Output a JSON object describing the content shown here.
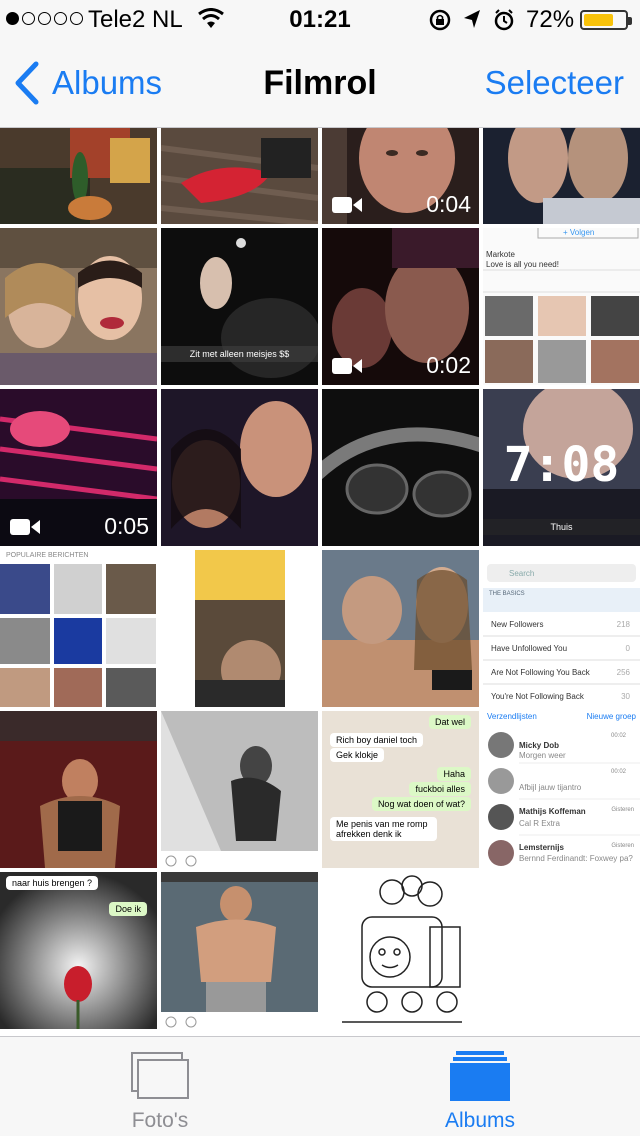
{
  "status_bar": {
    "carrier": "Tele2 NL",
    "time": "01:21",
    "battery_percent": "72%",
    "battery_level": 0.72,
    "signal_bars_filled": 1,
    "signal_bars_total": 5,
    "icons": [
      "wifi-icon",
      "orientation-lock-icon",
      "location-arrow-icon",
      "alarm-icon",
      "battery-icon"
    ]
  },
  "nav": {
    "back_label": "Albums",
    "title": "Filmrol",
    "select_label": "Selecteer"
  },
  "grid": {
    "video_durations": [
      "0:04",
      "0:02",
      "0:05"
    ],
    "captions": {
      "snap_text": "Zit met alleen meisjes $$",
      "clock_text": "7:08",
      "thuis": "Thuis"
    },
    "profile_shot": {
      "name": "Markote",
      "bio": "Love is all you need!",
      "follow": "+ Volgen"
    },
    "popular_shot": {
      "header": "POPULAIRE BERICHTEN"
    },
    "followers_app": {
      "search": "Search",
      "section": "THE BASICS",
      "rows": [
        {
          "label": "New Followers",
          "value": "218"
        },
        {
          "label": "Have Unfollowed You",
          "value": "0"
        },
        {
          "label": "Are Not Following You Back",
          "value": "256"
        },
        {
          "label": "You're Not Following Back",
          "value": "30"
        }
      ]
    },
    "chat_shot": {
      "messages": [
        "Dat wel",
        "Rich boy daniel toch",
        "Gek klokje",
        "Haha",
        "fuckboi alles",
        "Nog wat doen of wat?",
        "Me penis van me romp afrekken denk ik"
      ]
    },
    "whatsapp_list": {
      "left_header": "Verzendlijsten",
      "right_header": "Nieuwe groep",
      "chats": [
        {
          "name": "Micky Dob",
          "msg": "Morgen weer",
          "time": "00:02"
        },
        {
          "name": "",
          "msg": "Afbijl jauw tijantro",
          "time": "00:02"
        },
        {
          "name": "Mathijs Koffeman",
          "msg": "Cal R Extra",
          "time": "Gisteren"
        },
        {
          "name": "Lemsternijs",
          "msg": "Bernnd Ferdinandt: Foxwey pa?",
          "time": "Gisteren"
        }
      ]
    },
    "chat_shot_2": {
      "messages": [
        "naar huis brengen ?",
        "Doe ik"
      ]
    }
  },
  "tabbar": {
    "photos_label": "Foto's",
    "albums_label": "Albums",
    "active": "Albums",
    "colors": {
      "active": "#1a7cf2",
      "inactive": "#8e8e93"
    }
  }
}
